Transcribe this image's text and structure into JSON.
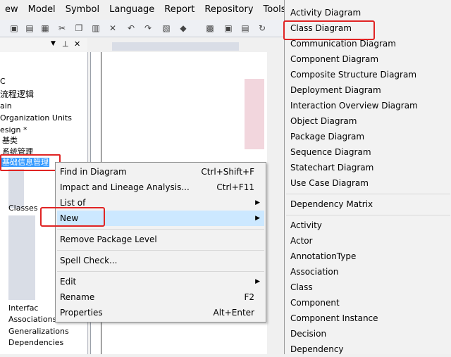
{
  "menu": [
    "ew",
    "Model",
    "Symbol",
    "Language",
    "Report",
    "Repository",
    "Tools"
  ],
  "tree": {
    "items": [
      "C",
      "流程逻辑",
      "ain",
      "Organization Units",
      "esign *",
      "基类",
      "系统管理",
      "基础信息管理",
      "Classes",
      "Interfac",
      "Associations",
      "Generalizations",
      "Dependencies"
    ]
  },
  "context_menu": {
    "find": "Find in Diagram",
    "find_sc": "Ctrl+Shift+F",
    "impact": "Impact and Lineage Analysis...",
    "impact_sc": "Ctrl+F11",
    "listof": "List of",
    "new": "New",
    "remove": "Remove Package Level",
    "spell": "Spell Check...",
    "edit": "Edit",
    "rename": "Rename",
    "rename_sc": "F2",
    "props": "Properties",
    "props_sc": "Alt+Enter"
  },
  "submenu": {
    "items": [
      "Activity Diagram",
      "Class Diagram",
      "Communication Diagram",
      "Component Diagram",
      "Composite Structure Diagram",
      "Deployment Diagram",
      "Interaction Overview Diagram",
      "Object Diagram",
      "Package Diagram",
      "Sequence Diagram",
      "Statechart Diagram",
      "Use Case Diagram"
    ],
    "matrix": "Dependency Matrix",
    "objects": [
      "Activity",
      "Actor",
      "AnnotationType",
      "Association",
      "Class",
      "Component",
      "Component Instance",
      "Decision",
      "Dependency"
    ]
  },
  "colors": {
    "highlight": "#e02424",
    "selection": "#3399ff",
    "hover": "#cce8ff"
  }
}
